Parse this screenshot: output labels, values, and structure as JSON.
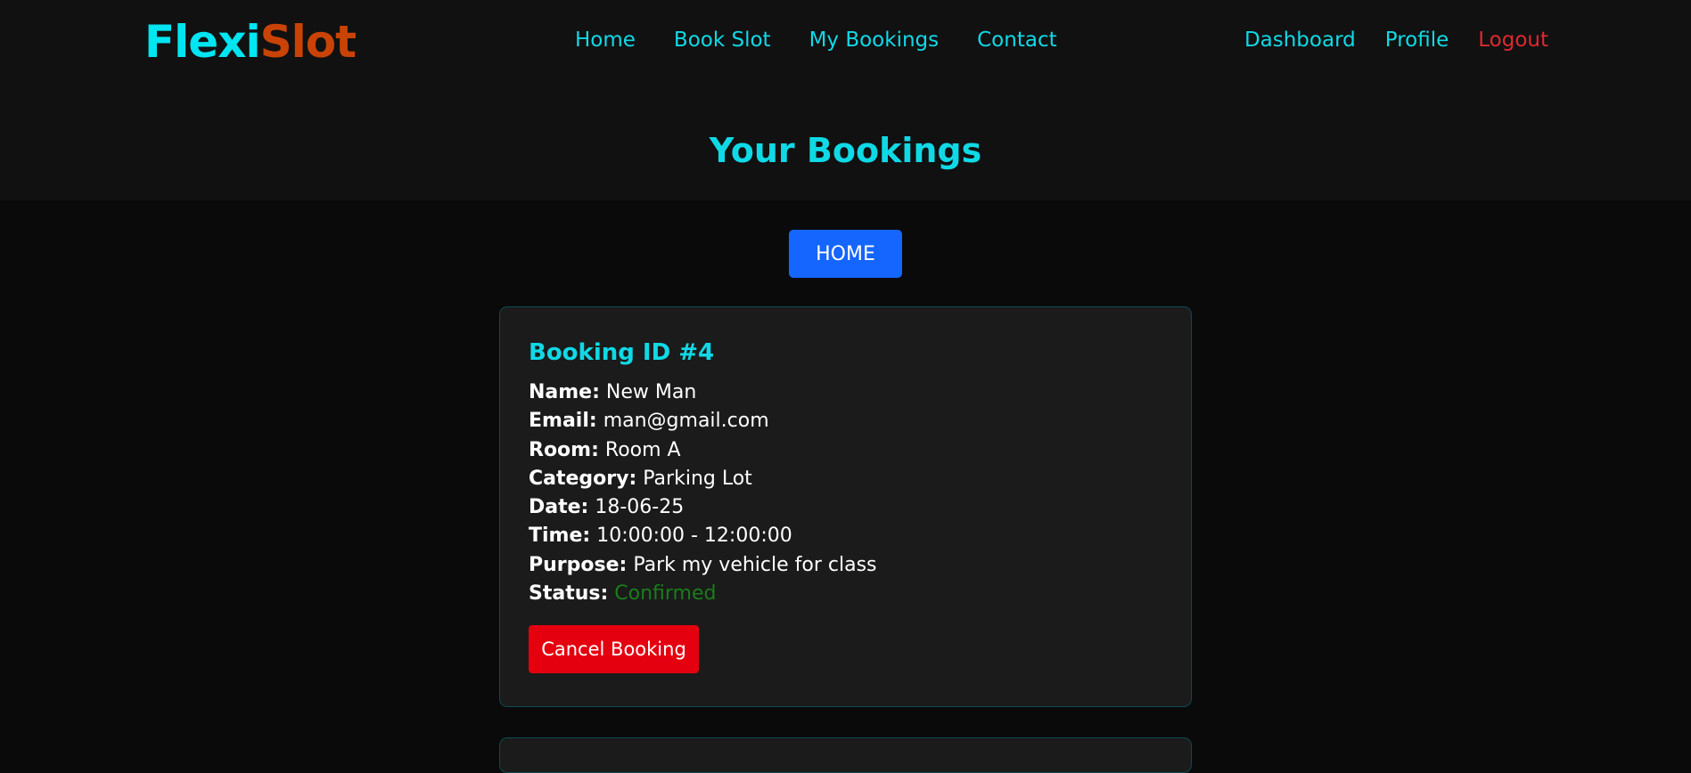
{
  "brand": {
    "part1": "Flexi",
    "part2": "Slot"
  },
  "nav_main": [
    {
      "label": "Home",
      "name": "nav-home-link"
    },
    {
      "label": "Book Slot",
      "name": "nav-book-slot-link"
    },
    {
      "label": "My Bookings",
      "name": "nav-my-bookings-link"
    },
    {
      "label": "Contact",
      "name": "nav-contact-link"
    }
  ],
  "nav_user": [
    {
      "label": "Dashboard",
      "name": "nav-dashboard-link"
    },
    {
      "label": "Profile",
      "name": "nav-profile-link"
    },
    {
      "label": "Logout",
      "name": "nav-logout-link"
    }
  ],
  "page_title": "Your Bookings",
  "home_button_label": "HOME",
  "booking": {
    "title": "Booking ID #4",
    "fields": [
      {
        "label": "Name:",
        "value": "New Man"
      },
      {
        "label": "Email:",
        "value": "man@gmail.com"
      },
      {
        "label": "Room:",
        "value": "Room A"
      },
      {
        "label": "Category:",
        "value": "Parking Lot"
      },
      {
        "label": "Date:",
        "value": "18-06-25"
      },
      {
        "label": "Time:",
        "value": "10:00:00 - 12:00:00"
      },
      {
        "label": "Purpose:",
        "value": "Park my vehicle for class"
      },
      {
        "label": "Status:",
        "value": "Confirmed"
      }
    ],
    "cancel_label": "Cancel Booking"
  },
  "colors": {
    "accent": "#10d9e6",
    "brand_secondary": "#c94306",
    "logout": "#e0282f",
    "home_button": "#1565ff",
    "cancel_button": "#e5000f",
    "status_confirmed": "#1a7d1a"
  }
}
